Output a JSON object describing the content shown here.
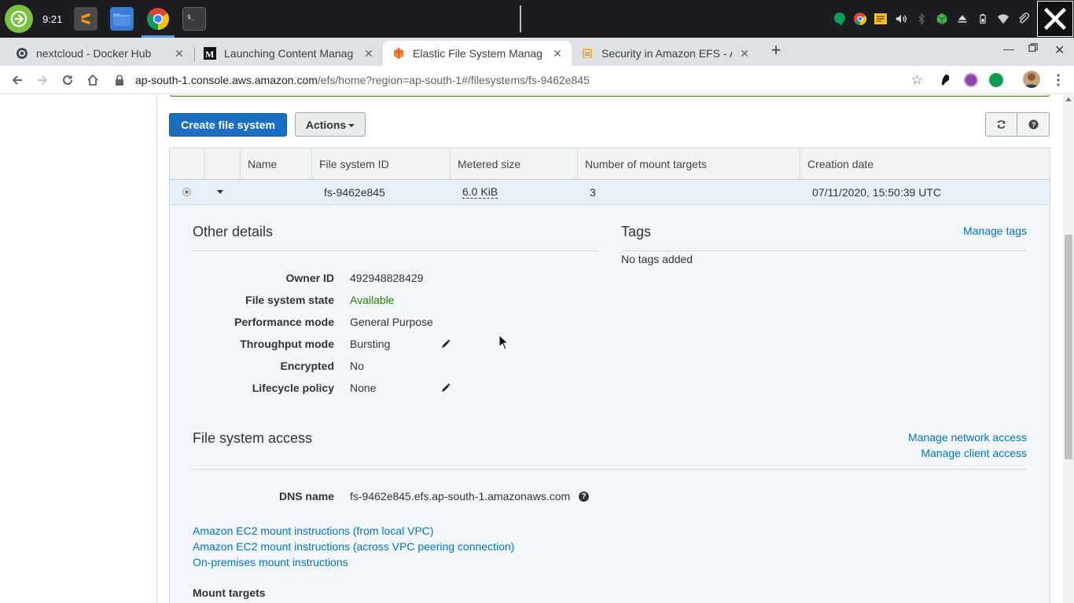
{
  "taskbar": {
    "time": "9:21",
    "apps": [
      "sublime-text",
      "files",
      "chrome",
      "terminal"
    ]
  },
  "tabs": [
    {
      "label": "nextcloud - Docker Hub",
      "icon": "docker-icon"
    },
    {
      "label": "Launching Content Manag",
      "icon": "medium-icon"
    },
    {
      "label": "Elastic File System Manag",
      "icon": "aws-icon"
    },
    {
      "label": "Security in Amazon EFS - A",
      "icon": "aws-docs-icon"
    }
  ],
  "url": {
    "host": "ap-south-1.console.aws.amazon.com",
    "path": "/efs/home?region=ap-south-1#/filesystems/fs-9462e845"
  },
  "toolbar": {
    "create_label": "Create file system",
    "actions_label": "Actions"
  },
  "table": {
    "headers": [
      "Name",
      "File system ID",
      "Metered size",
      "Number of mount targets",
      "Creation date"
    ],
    "row": {
      "name": "",
      "id": "fs-9462e845",
      "size": "6.0 KiB",
      "mount_targets": "3",
      "created": "07/11/2020, 15:50:39 UTC"
    }
  },
  "other_details": {
    "title": "Other details",
    "fields": [
      {
        "label": "Owner ID",
        "value": "492948828429"
      },
      {
        "label": "File system state",
        "value": "Available"
      },
      {
        "label": "Performance mode",
        "value": "General Purpose"
      },
      {
        "label": "Throughput mode",
        "value": "Bursting"
      },
      {
        "label": "Encrypted",
        "value": "No"
      },
      {
        "label": "Lifecycle policy",
        "value": "None"
      }
    ],
    "status_color": "#1d8102"
  },
  "tags": {
    "title": "Tags",
    "manage_label": "Manage tags",
    "empty_text": "No tags added"
  },
  "access": {
    "title": "File system access",
    "manage_network": "Manage network access",
    "manage_client": "Manage client access",
    "dns_label": "DNS name",
    "dns_value": "fs-9462e845.efs.ap-south-1.amazonaws.com",
    "links": [
      "Amazon EC2 mount instructions (from local VPC)",
      "Amazon EC2 mount instructions (across VPC peering connection)",
      "On-premises mount instructions"
    ],
    "mount_targets_label": "Mount targets"
  },
  "colors": {
    "primary_button": "#1a6ec3",
    "link": "#0073bb",
    "selected_row": "#e6f0fa"
  }
}
